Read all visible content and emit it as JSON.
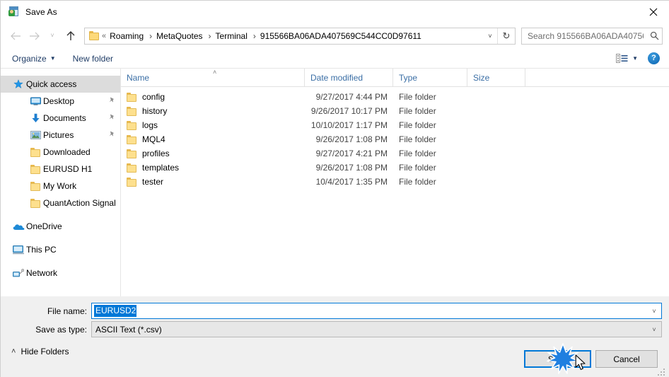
{
  "window": {
    "title": "Save As",
    "icon": "save-as-icon",
    "close_label": "✕"
  },
  "nav": {
    "back_icon": "arrow-left-icon",
    "forward_icon": "arrow-right-icon",
    "recent_icon": "chevron-down-icon",
    "up_icon": "arrow-up-icon",
    "breadcrumb_prefix": "«",
    "breadcrumbs": [
      "Roaming",
      "MetaQuotes",
      "Terminal",
      "915566BA06ADA407569C544CC0D97611"
    ],
    "separator": "›",
    "dropdown_icon": "chevron-down-icon",
    "refresh_icon": "refresh-icon",
    "refresh_glyph": "↻"
  },
  "search": {
    "placeholder": "Search 915566BA06ADA40756...",
    "value": "",
    "icon": "search-icon"
  },
  "toolbar": {
    "organize_label": "Organize",
    "organize_caret": "▼",
    "new_folder_label": "New folder",
    "view_icon": "view-options-icon",
    "view_caret": "▼",
    "help_label": "?"
  },
  "sidebar": {
    "items": [
      {
        "label": "Quick access",
        "icon": "star-icon",
        "level": "root",
        "selected": true,
        "pinned": false
      },
      {
        "label": "Desktop",
        "icon": "desktop-icon",
        "level": "child",
        "selected": false,
        "pinned": true
      },
      {
        "label": "Documents",
        "icon": "download-arrow-icon",
        "level": "child",
        "selected": false,
        "pinned": true
      },
      {
        "label": "Pictures",
        "icon": "pictures-icon",
        "level": "child",
        "selected": false,
        "pinned": true
      },
      {
        "label": "Downloaded",
        "icon": "folder-icon",
        "level": "child",
        "selected": false,
        "pinned": false
      },
      {
        "label": "EURUSD H1",
        "icon": "folder-icon",
        "level": "child",
        "selected": false,
        "pinned": false
      },
      {
        "label": "My Work",
        "icon": "folder-icon",
        "level": "child",
        "selected": false,
        "pinned": false
      },
      {
        "label": "QuantAction Signal",
        "icon": "folder-icon",
        "level": "child",
        "selected": false,
        "pinned": false
      },
      {
        "label": "OneDrive",
        "icon": "onedrive-cloud-icon",
        "level": "root",
        "selected": false,
        "pinned": false,
        "gap_before": true
      },
      {
        "label": "This PC",
        "icon": "this-pc-icon",
        "level": "root",
        "selected": false,
        "pinned": false,
        "gap_before": true
      },
      {
        "label": "Network",
        "icon": "network-icon",
        "level": "root",
        "selected": false,
        "pinned": false,
        "gap_before": true
      }
    ]
  },
  "filelist": {
    "columns": [
      "Name",
      "Date modified",
      "Type",
      "Size"
    ],
    "sort_column": "Name",
    "sort_caret": "˄",
    "rows": [
      {
        "name": "config",
        "date": "9/27/2017 4:44 PM",
        "type": "File folder",
        "size": "",
        "icon": "folder-icon"
      },
      {
        "name": "history",
        "date": "9/26/2017 10:17 PM",
        "type": "File folder",
        "size": "",
        "icon": "folder-icon"
      },
      {
        "name": "logs",
        "date": "10/10/2017 1:17 PM",
        "type": "File folder",
        "size": "",
        "icon": "folder-icon"
      },
      {
        "name": "MQL4",
        "date": "9/26/2017 1:08 PM",
        "type": "File folder",
        "size": "",
        "icon": "folder-icon"
      },
      {
        "name": "profiles",
        "date": "9/27/2017 4:21 PM",
        "type": "File folder",
        "size": "",
        "icon": "folder-icon"
      },
      {
        "name": "templates",
        "date": "9/26/2017 1:08 PM",
        "type": "File folder",
        "size": "",
        "icon": "folder-icon"
      },
      {
        "name": "tester",
        "date": "10/4/2017 1:35 PM",
        "type": "File folder",
        "size": "",
        "icon": "folder-icon"
      }
    ]
  },
  "bottom": {
    "filename_label": "File name:",
    "filename_value": "EURUSD2",
    "filetype_label": "Save as type:",
    "filetype_value": "ASCII Text (*.csv)",
    "combo_caret": "˅",
    "hide_folders_label": "Hide Folders",
    "hide_folders_caret": "˄",
    "save_label": "Save",
    "cancel_label": "Cancel"
  },
  "colors": {
    "accent": "#0078d7",
    "selection": "#0078d7",
    "column_header_text": "#3a6ea5",
    "folder": "#fde08e",
    "panel": "#f0f0f0"
  }
}
